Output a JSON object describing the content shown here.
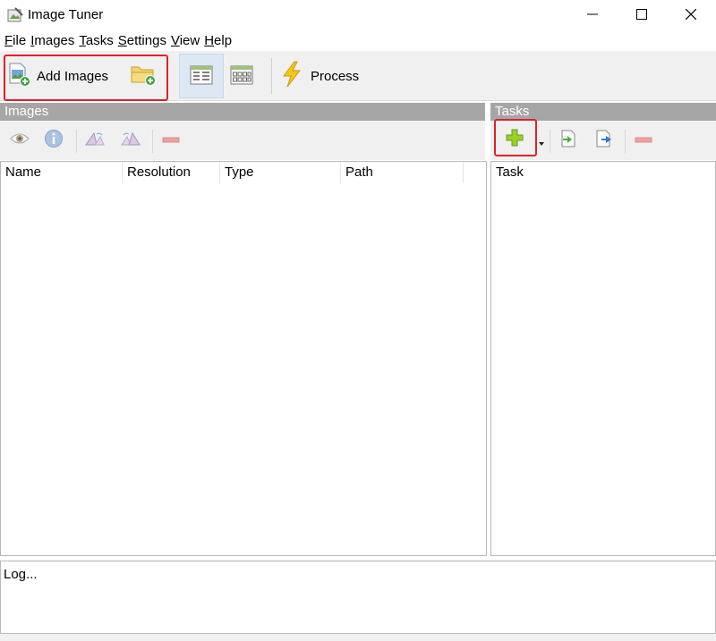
{
  "window": {
    "title": "Image Tuner",
    "icon": "app-logo-icon"
  },
  "menu": {
    "items": [
      {
        "label_first": "F",
        "label_rest": "ile"
      },
      {
        "label_first": "I",
        "label_rest": "mages"
      },
      {
        "label_first": "T",
        "label_rest": "asks"
      },
      {
        "label_first": "S",
        "label_rest": "ettings"
      },
      {
        "label_first": "V",
        "label_rest": "iew"
      },
      {
        "label_first": "H",
        "label_rest": "elp"
      }
    ]
  },
  "toolbar": {
    "add_images_label": "Add Images",
    "process_label": "Process"
  },
  "images_panel": {
    "header": "Images",
    "columns": [
      "Name",
      "Resolution",
      "Type",
      "Path"
    ]
  },
  "tasks_panel": {
    "header": "Tasks",
    "columns": [
      "Task"
    ]
  },
  "log": {
    "text": "Log..."
  },
  "colors": {
    "highlight": "#e0202a",
    "panel_header": "#a6a6a6",
    "toolbar_bg": "#f0f0f0"
  }
}
